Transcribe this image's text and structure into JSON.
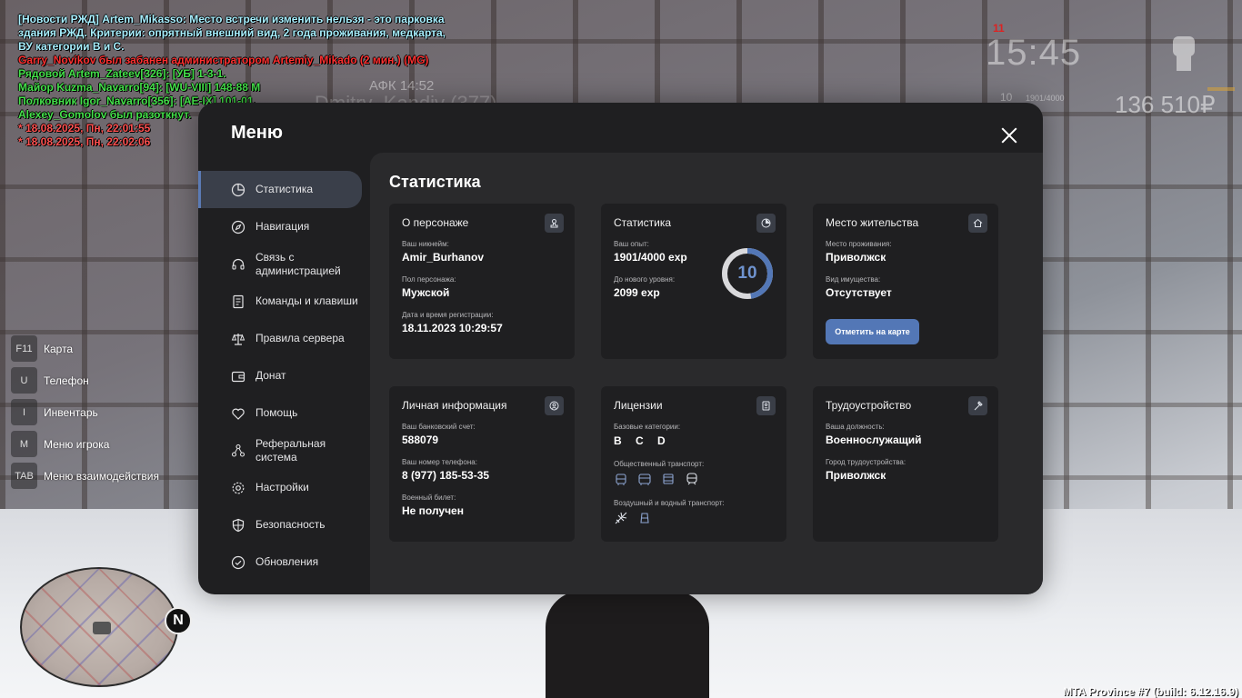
{
  "chat": [
    {
      "text": "[Новости РЖД] Artem_Mikasso: Место встречи изменить нельзя - это парковка",
      "color": "#a8f0ff"
    },
    {
      "text": " здания РЖД. Критерии: опрятный внешний вид, 2 года проживания, медкарта,",
      "color": "#a8f0ff"
    },
    {
      "text": " ВУ категории В и С.",
      "color": "#a8f0ff"
    },
    {
      "text": "Garry_Novikov был забанен администратором Artemiy_Mikado (2 мин.) (MG)",
      "color": "#ff3030"
    },
    {
      "text": "Рядовой Artem_Zateev[326]: [УБ] 1-3-1.",
      "color": "#44e04a"
    },
    {
      "text": "Майор Kuzma_Navarro[94]: [WU-VIII] 148-88 М",
      "color": "#44e04a"
    },
    {
      "text": "Полковник Igor_Navarro[356]: [АЕ-IX] 101-01.",
      "color": "#44e04a"
    },
    {
      "text": "Alexey_Gomolov был разоткнут.",
      "color": "#44e04a"
    },
    {
      "text": "* 18.08.2025, Пн, 22:01:55",
      "color": "#ff5050"
    },
    {
      "text": "* 18.08.2025, Пн, 22:02:06",
      "color": "#ff5050"
    }
  ],
  "hud": {
    "clock": "15:45",
    "red_mark": "11",
    "level": "10",
    "exp": "1901/4000",
    "money": "136 510₽"
  },
  "afk": "АФК 14:52",
  "ghost_name": "Dmitry_Kandiv (377)",
  "hotkeys": [
    {
      "key": "F11",
      "label": "Карта"
    },
    {
      "key": "U",
      "label": "Телефон"
    },
    {
      "key": "I",
      "label": "Инвентарь"
    },
    {
      "key": "M",
      "label": "Меню игрока"
    },
    {
      "key": "TAB",
      "label": "Меню взаимодействия"
    }
  ],
  "radar": {
    "north": "N"
  },
  "build": "MTA Province #7 (build: 6.12.16.9)",
  "menu": {
    "title": "Меню",
    "sidebar": [
      {
        "label": "Статистика",
        "icon": "chart-pie-icon",
        "active": true
      },
      {
        "label": "Навигация",
        "icon": "compass-icon"
      },
      {
        "label_1": "Связь с",
        "label_2": "администрацией",
        "icon": "headset-icon"
      },
      {
        "label": "Команды и клавиши",
        "icon": "document-icon"
      },
      {
        "label": "Правила сервера",
        "icon": "scales-icon"
      },
      {
        "label": "Донат",
        "icon": "wallet-icon"
      },
      {
        "label": "Помощь",
        "icon": "heart-hands-icon"
      },
      {
        "label_1": "Реферальная",
        "label_2": "система",
        "icon": "people-network-icon"
      },
      {
        "label": "Настройки",
        "icon": "gear-icon"
      },
      {
        "label": "Безопасность",
        "icon": "shield-icon"
      },
      {
        "label": "Обновления",
        "icon": "check-circle-icon"
      }
    ],
    "content_title": "Статистика",
    "cards": {
      "character": {
        "title": "О персонаже",
        "nick_label": "Ваш никнейм:",
        "nick": "Amir_Burhanov",
        "gender_label": "Пол персонажа:",
        "gender": "Мужской",
        "reg_label": "Дата и время регистрации:",
        "reg": "18.11.2023 10:29:57"
      },
      "stats": {
        "title": "Статистика",
        "exp_label": "Ваш опыт:",
        "exp": "1901/4000 exp",
        "next_label": "До нового уровня:",
        "next": "2099 exp",
        "level": "10",
        "progress": 0.475
      },
      "residence": {
        "title": "Место жительства",
        "place_label": "Место проживания:",
        "place": "Приволжск",
        "property_label": "Вид имущества:",
        "property": "Отсутствует",
        "button": "Отметить на карте"
      },
      "personal": {
        "title": "Личная информация",
        "bank_label": "Ваш банковский счет:",
        "bank": "588079",
        "phone_label": "Ваш номер телефона:",
        "phone": "8 (977) 185-53-35",
        "military_label": "Военный билет:",
        "military": "Не получен"
      },
      "licenses": {
        "title": "Лицензии",
        "base_label": "Базовые категории:",
        "base": "B C D",
        "public_label": "Общественный транспорт:",
        "public_icons": [
          "trolleybus-icon",
          "bus-icon",
          "tram-icon",
          "train-icon"
        ],
        "air_label": "Воздушный и водный транспорт:",
        "air_icons": [
          "plane-icon",
          "boat-icon"
        ]
      },
      "employment": {
        "title": "Трудоустройство",
        "position_label": "Ваша должность:",
        "position": "Военнослужащий",
        "city_label": "Город трудоустройства:",
        "city": "Приволжск"
      }
    }
  },
  "colors": {
    "accent": "#5377b6",
    "ring": "#6f93cf"
  }
}
